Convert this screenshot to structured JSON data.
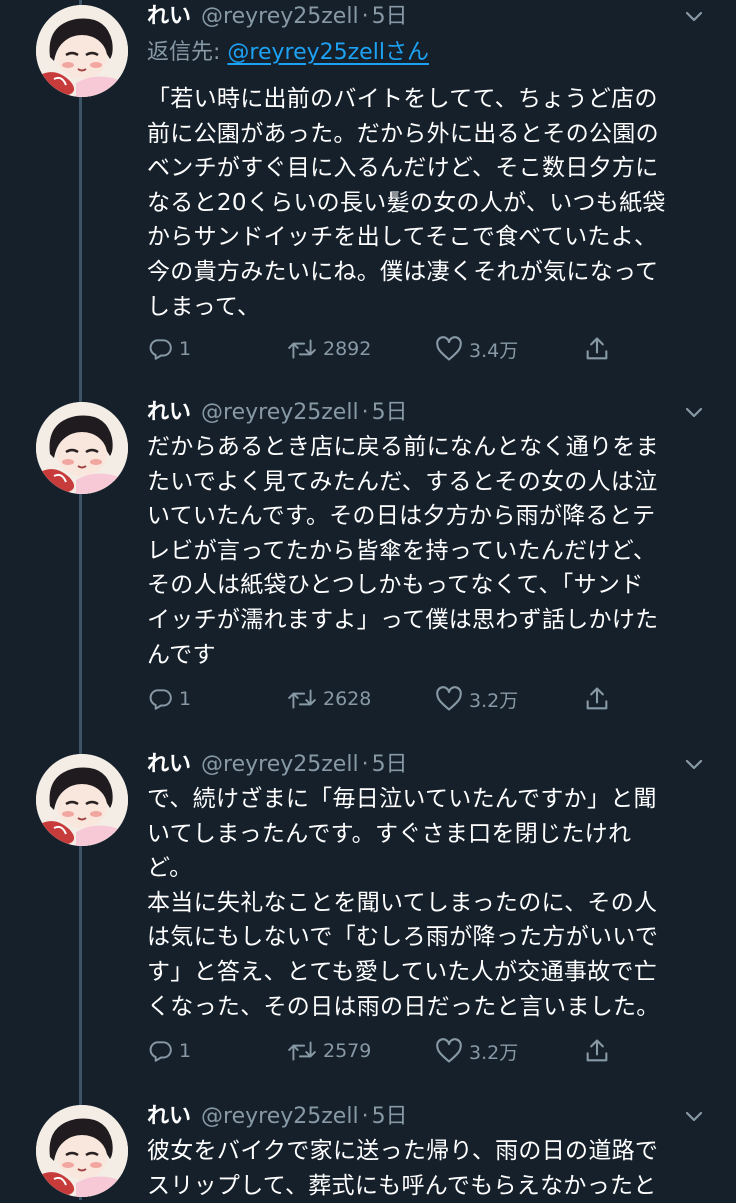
{
  "tweets": [
    {
      "name": "れい",
      "handle": "@reyrey25zell",
      "separator": "·",
      "time": "5日",
      "reply_label": "返信先: ",
      "reply_mention": "@reyrey25zellさん",
      "text": "「若い時に出前のバイトをしてて、ちょうど店の\n前に公園があった。だから外に出るとその公園の\nベンチがすぐ目に入るんだけど、そこ数日夕方に\nなると20くらいの長い髪の女の人が、いつも紙袋\nからサンドイッチを出してそこで食べていたよ、\n今の貴方みたいにね。僕は凄くそれが気になって\nしまって、",
      "replies": "1",
      "retweets": "2892",
      "likes": "3.4万"
    },
    {
      "name": "れい",
      "handle": "@reyrey25zell",
      "separator": "·",
      "time": "5日",
      "text": "だからあるとき店に戻る前になんとなく通りをま\nたいでよく見てみたんだ、するとその女の人は泣\nいていたんです。その日は夕方から雨が降るとテ\nレビが言ってたから皆傘を持っていたんだけど、\nその人は紙袋ひとつしかもってなくて、「サンド\nイッチが濡れますよ」って僕は思わず話しかけた\nんです",
      "replies": "1",
      "retweets": "2628",
      "likes": "3.2万"
    },
    {
      "name": "れい",
      "handle": "@reyrey25zell",
      "separator": "·",
      "time": "5日",
      "text": "で、続けざまに「毎日泣いていたんですか」と聞\nいてしまったんです。すぐさま口を閉じたけれ\nど。\n本当に失礼なことを聞いてしまったのに、その人\nは気にもしないで「むしろ雨が降った方がいいで\nす」と答え、とても愛していた人が交通事故で亡\nくなった、その日は雨の日だったと言いました。",
      "replies": "1",
      "retweets": "2579",
      "likes": "3.2万"
    },
    {
      "name": "れい",
      "handle": "@reyrey25zell",
      "separator": "·",
      "time": "5日",
      "text": "彼女をバイクで家に送った帰り、雨の日の道路で\nスリップして、葬式にも呼んでもらえなかったと"
    }
  ]
}
